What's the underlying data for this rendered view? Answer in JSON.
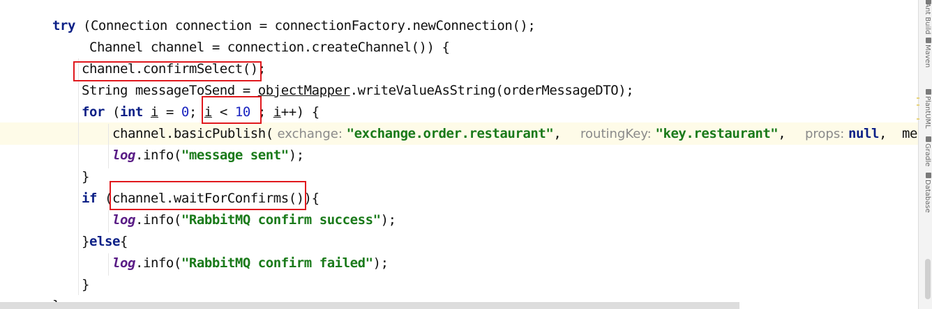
{
  "code": {
    "l1": {
      "kw_try": "try",
      "rest": " (Connection connection = connectionFactory.newConnection();"
    },
    "l2": {
      "text": "Channel channel = connection.createChannel()) {"
    },
    "l3": {
      "text": "channel.confirmSelect();"
    },
    "l4": {
      "before": "String messageToSend = ",
      "underlined": "objectMapper",
      "after": ".writeValueAsString(orderMessageDTO);"
    },
    "l5": {
      "kw_for": "for",
      "open": " (",
      "kw_int": "int",
      "sp": " ",
      "i1": "i",
      "eq": " = ",
      "zero": "0",
      "semi1": "; ",
      "i2": "i",
      "lt": " < ",
      "ten": "10",
      "semi2": " ; ",
      "i3": "i",
      "rest": "++) {"
    },
    "l6": {
      "call": "channel.basicPublish(",
      "hint_exchange": " exchange: ",
      "str_exchange": "\"exchange.order.restaurant\"",
      "comma1": ",  ",
      "hint_routing": " routingKey: ",
      "str_routing": "\"key.restaurant\"",
      "comma2": ",  ",
      "hint_props": " props: ",
      "kw_null": "null",
      "comma3": ",  ",
      "tail": "me"
    },
    "l7": {
      "log": "log",
      "dot": ".info(",
      "str": "\"message sent\"",
      "end": ");"
    },
    "l8": {
      "text": "}"
    },
    "l9": {
      "kw_if": "if",
      "rest": " (channel.waitForConfirms()){"
    },
    "l10": {
      "log": "log",
      "dot": ".info(",
      "str": "\"RabbitMQ confirm success\"",
      "end": ");"
    },
    "l11": {
      "close": "}",
      "kw_else": "else",
      "open": "{"
    },
    "l12": {
      "log": "log",
      "dot": ".info(",
      "str": "\"RabbitMQ confirm failed\"",
      "end": ");"
    },
    "l13": {
      "text": "}"
    },
    "l14": {
      "text": "}"
    }
  },
  "sidebar": {
    "tabs": [
      "Ant Build",
      "Maven",
      "PlantUML",
      "Gradle",
      "Database"
    ]
  },
  "colors": {
    "keyword": "#0b1f86",
    "string": "#1a7a1a",
    "number": "#1a24c0",
    "log_field": "#5a1d86",
    "annotation_box": "#e0181d",
    "current_line": "#fefbe8"
  }
}
